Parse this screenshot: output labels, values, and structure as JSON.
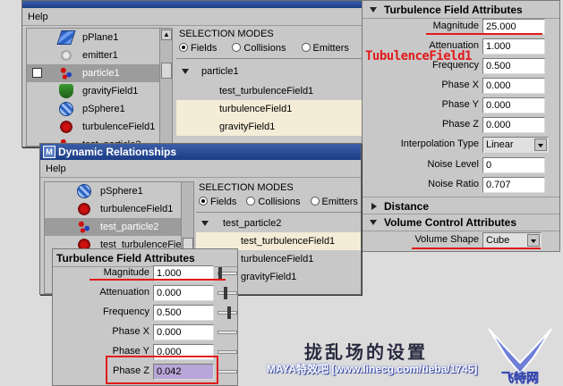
{
  "win_top": {
    "menu": "Help",
    "outliner": [
      "pPlane1",
      "emitter1",
      "particle1",
      "gravityField1",
      "pSphere1",
      "turbulenceField1",
      "test_particle2"
    ],
    "selected_index": 2,
    "selmodes": {
      "title": "SELECTION MODES",
      "fields": "Fields",
      "collisions": "Collisions",
      "emitters": "Emitters",
      "tree": [
        "particle1",
        "test_turbulenceField1",
        "turbulenceField1",
        "gravityField1"
      ]
    }
  },
  "win_main": {
    "title": "Dynamic Relationships",
    "menu": "Help",
    "outliner": [
      "pSphere1",
      "turbulenceField1",
      "test_particle2",
      "test_turbulenceField1"
    ],
    "selected_index": 2,
    "selmodes": {
      "title": "SELECTION MODES",
      "fields": "Fields",
      "collisions": "Collisions",
      "emitters": "Emitters",
      "tree": [
        "test_particle2",
        "test_turbulenceField1",
        "turbulenceField1",
        "gravityField1"
      ]
    }
  },
  "attr_right": {
    "header": "Turbulence Field Attributes",
    "rows": [
      {
        "label": "Magnitude",
        "value": "25.000"
      },
      {
        "label": "Attenuation",
        "value": "1.000"
      },
      {
        "label": "Frequency",
        "value": "0.500"
      },
      {
        "label": "Phase X",
        "value": "0.000"
      },
      {
        "label": "Phase Y",
        "value": "0.000"
      },
      {
        "label": "Phase Z",
        "value": "0.000"
      },
      {
        "label": "Interpolation Type",
        "value": "Linear"
      },
      {
        "label": "Noise Level",
        "value": "0"
      },
      {
        "label": "Noise Ratio",
        "value": "0.707"
      }
    ],
    "distance_header": "Distance",
    "volume_header": "Volume Control Attributes",
    "volume_shape_label": "Volume Shape",
    "volume_shape_value": "Cube",
    "annotation": "TubulenceField1"
  },
  "attr_left": {
    "header": "Turbulence Field Attributes",
    "rows": [
      {
        "label": "Magnitude",
        "value": "1.000"
      },
      {
        "label": "Attenuation",
        "value": "0.000"
      },
      {
        "label": "Frequency",
        "value": "0.500"
      },
      {
        "label": "Phase X",
        "value": "0.000"
      },
      {
        "label": "Phase Y",
        "value": "0.000"
      },
      {
        "label": "Phase Z",
        "value": "0.042"
      }
    ]
  },
  "watermark": "MAYA特效吧 [www.linecg.com/tieba/1745]",
  "big_text": "拢乱场的设置",
  "logo_text": "飞特网"
}
